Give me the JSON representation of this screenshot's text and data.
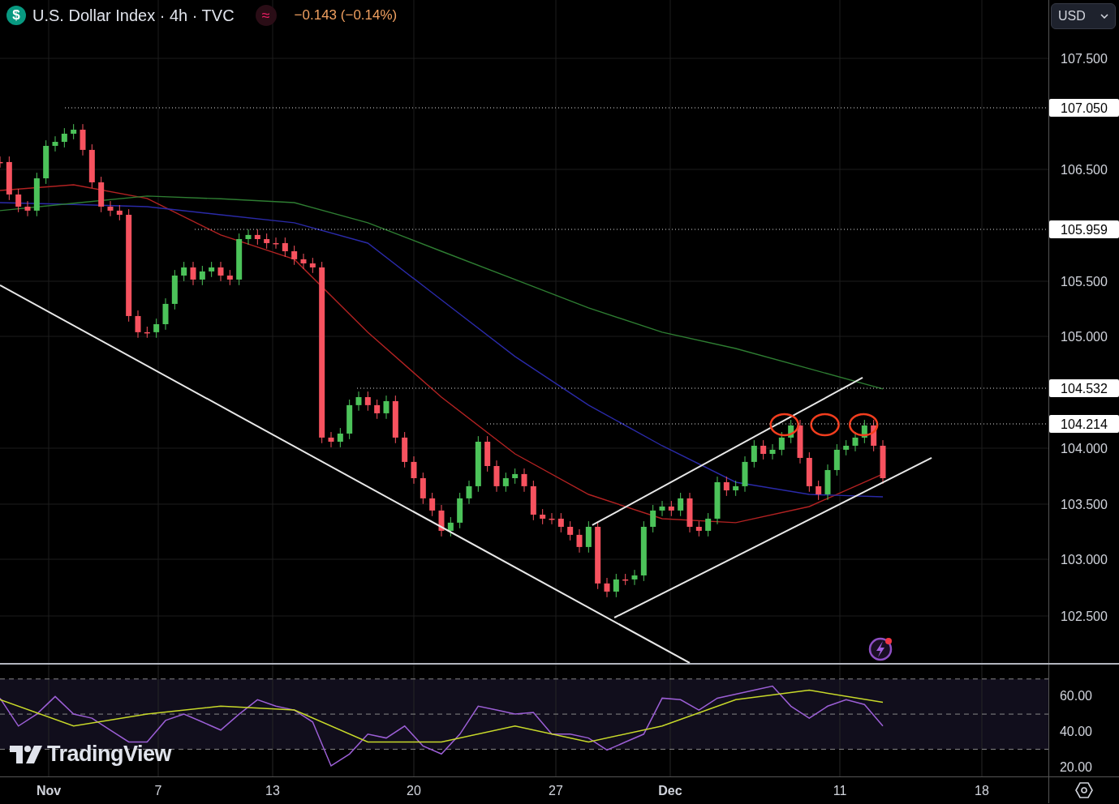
{
  "header": {
    "symbol_icon": "$",
    "title": "U.S. Dollar Index · 4h · TVC",
    "status_icon": "≈",
    "change": "−0.143 (−0.14%)"
  },
  "currency_select": {
    "value": "USD"
  },
  "price_axis": [
    {
      "kind": "tick",
      "text": "107.500"
    },
    {
      "kind": "marker",
      "text": "107.050"
    },
    {
      "kind": "tick",
      "text": "106.500"
    },
    {
      "kind": "marker",
      "text": "105.959"
    },
    {
      "kind": "tick",
      "text": "105.500"
    },
    {
      "kind": "tick",
      "text": "105.000"
    },
    {
      "kind": "marker",
      "text": "104.532"
    },
    {
      "kind": "marker",
      "text": "104.214"
    },
    {
      "kind": "tick",
      "text": "104.000"
    },
    {
      "kind": "tick",
      "text": "103.500"
    },
    {
      "kind": "tick",
      "text": "103.000"
    },
    {
      "kind": "tick",
      "text": "102.500"
    }
  ],
  "rsi_axis": [
    "60.00",
    "40.00",
    "20.00"
  ],
  "time_axis": [
    {
      "kind": "month",
      "text": "Nov"
    },
    {
      "kind": "day",
      "text": "7"
    },
    {
      "kind": "day",
      "text": "13"
    },
    {
      "kind": "day",
      "text": "20"
    },
    {
      "kind": "day",
      "text": "27"
    },
    {
      "kind": "month",
      "text": "Dec"
    },
    {
      "kind": "day",
      "text": "11"
    },
    {
      "kind": "day",
      "text": "18"
    }
  ],
  "branding": "TradingView"
}
